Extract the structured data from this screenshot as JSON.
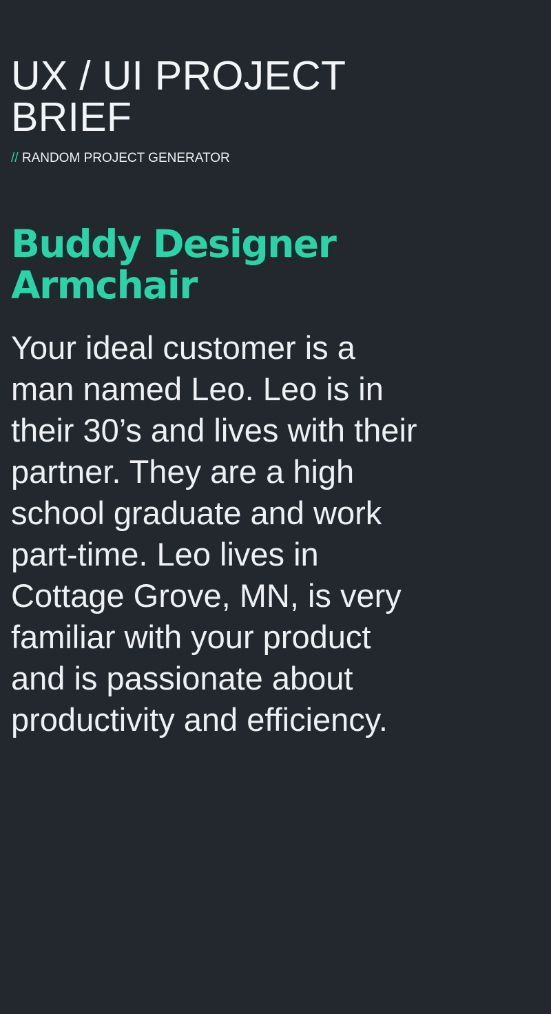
{
  "header": {
    "title": "UX / UI PROJECT BRIEF",
    "subtitle_prefix": "//",
    "subtitle": "RANDOM PROJECT GENERATOR"
  },
  "project": {
    "name": "Buddy Designer Armchair",
    "brief": "Your ideal customer is a man named Leo. Leo is in their 30’s and lives with their partner. They are a high school graduate and work part-time. Leo lives in Cottage Grove, MN, is very familiar with your product and is passionate about productivity and efficiency."
  },
  "colors": {
    "background": "#22282e",
    "accent": "#2ad4a8",
    "text": "#eef0f2"
  }
}
